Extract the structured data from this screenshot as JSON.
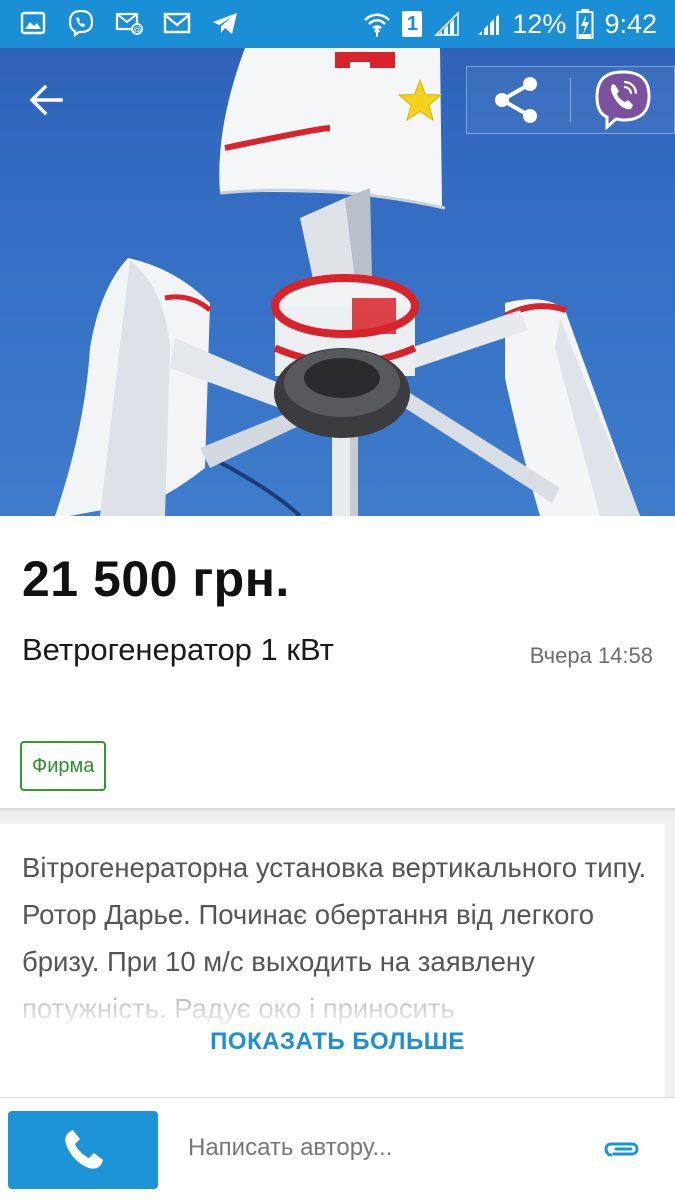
{
  "status_bar": {
    "battery_percent": "12%",
    "time": "9:42",
    "sim_number": "1",
    "left_icons": [
      "gallery-icon",
      "viber-icon",
      "sms-icon",
      "gmail-icon",
      "telegram-icon"
    ]
  },
  "listing": {
    "price": "21 500 грн.",
    "title": "Ветрогенератор 1 кВт",
    "date": "Вчера 14:58",
    "badge": "Фирма",
    "description": "Вітрогенераторна установка вертикального типу. Ротор Дарье. Починає обертання від легкого бризу. При 10 м/с выходить на заявлену потужність. Радує око і  приносить",
    "show_more": "ПОКАЗАТЬ БОЛЬШЕ"
  },
  "bottom_bar": {
    "message_placeholder": "Написать автору..."
  },
  "colors": {
    "status_bar": "#1a8fd6",
    "accent": "#1e94d8",
    "badge_green": "#2e9b2e",
    "star": "#f2d21a",
    "viber": "#7b519d"
  }
}
